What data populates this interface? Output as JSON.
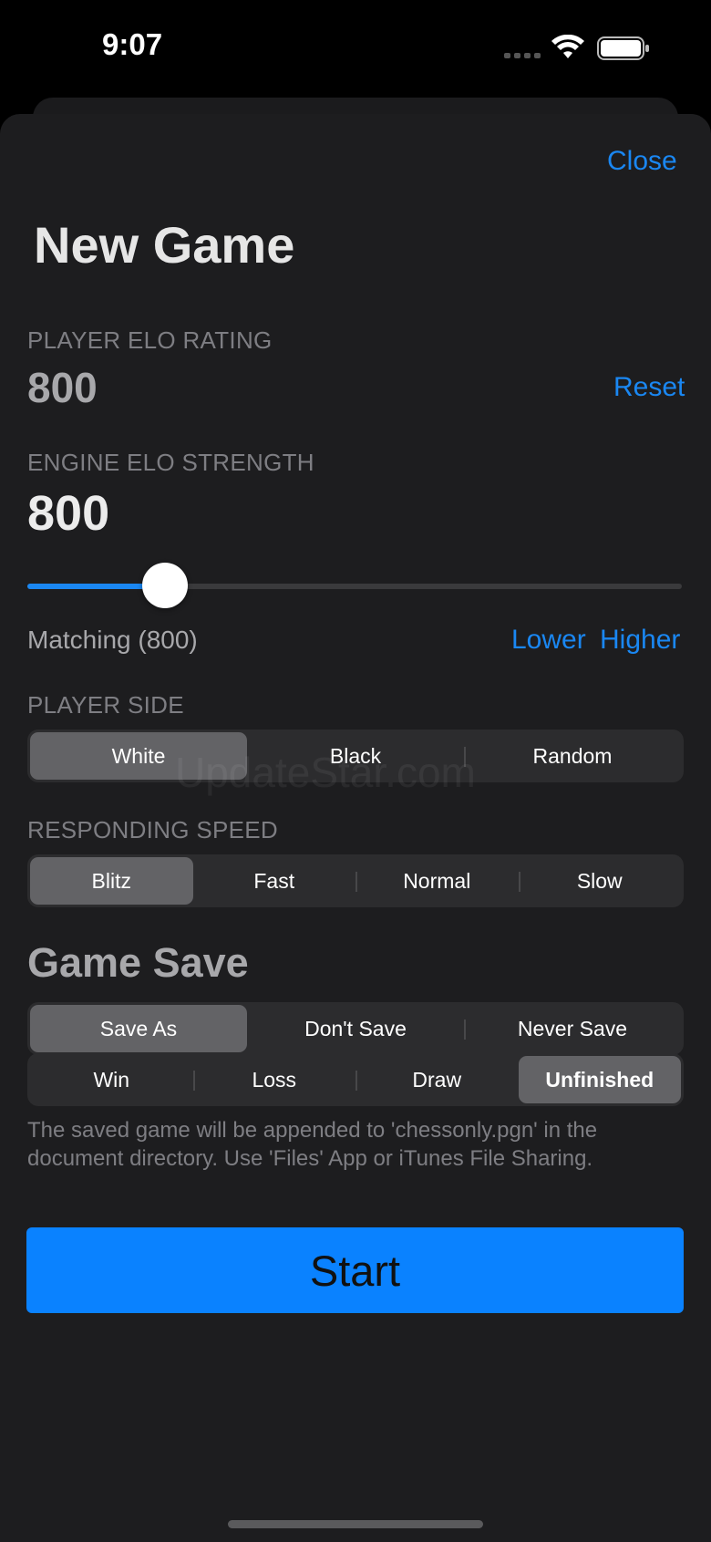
{
  "status_bar": {
    "time": "9:07"
  },
  "header": {
    "close_label": "Close",
    "title": "New Game"
  },
  "player_elo": {
    "label": "PLAYER ELO RATING",
    "value": "800",
    "reset_label": "Reset"
  },
  "engine_elo": {
    "label": "ENGINE ELO STRENGTH",
    "value": "800",
    "slider_fraction": 0.21,
    "matching_text": "Matching (800)",
    "lower_label": "Lower",
    "higher_label": "Higher"
  },
  "player_side": {
    "label": "PLAYER SIDE",
    "options": [
      "White",
      "Black",
      "Random"
    ],
    "selected": "White"
  },
  "responding_speed": {
    "label": "RESPONDING SPEED",
    "options": [
      "Blitz",
      "Fast",
      "Normal",
      "Slow"
    ],
    "selected": "Blitz"
  },
  "game_save": {
    "title": "Game Save",
    "save_options": [
      "Save As",
      "Don't Save",
      "Never Save"
    ],
    "save_selected": "Save As",
    "result_options": [
      "Win",
      "Loss",
      "Draw",
      "Unfinished"
    ],
    "result_selected": "Unfinished",
    "note": "The saved game will be appended to 'chessonly.pgn' in the document directory. Use 'Files' App or iTunes File Sharing."
  },
  "watermark": "UpdateStar.com",
  "start_label": "Start",
  "colors": {
    "accent": "#1a87f2",
    "start_button": "#0a82ff"
  }
}
